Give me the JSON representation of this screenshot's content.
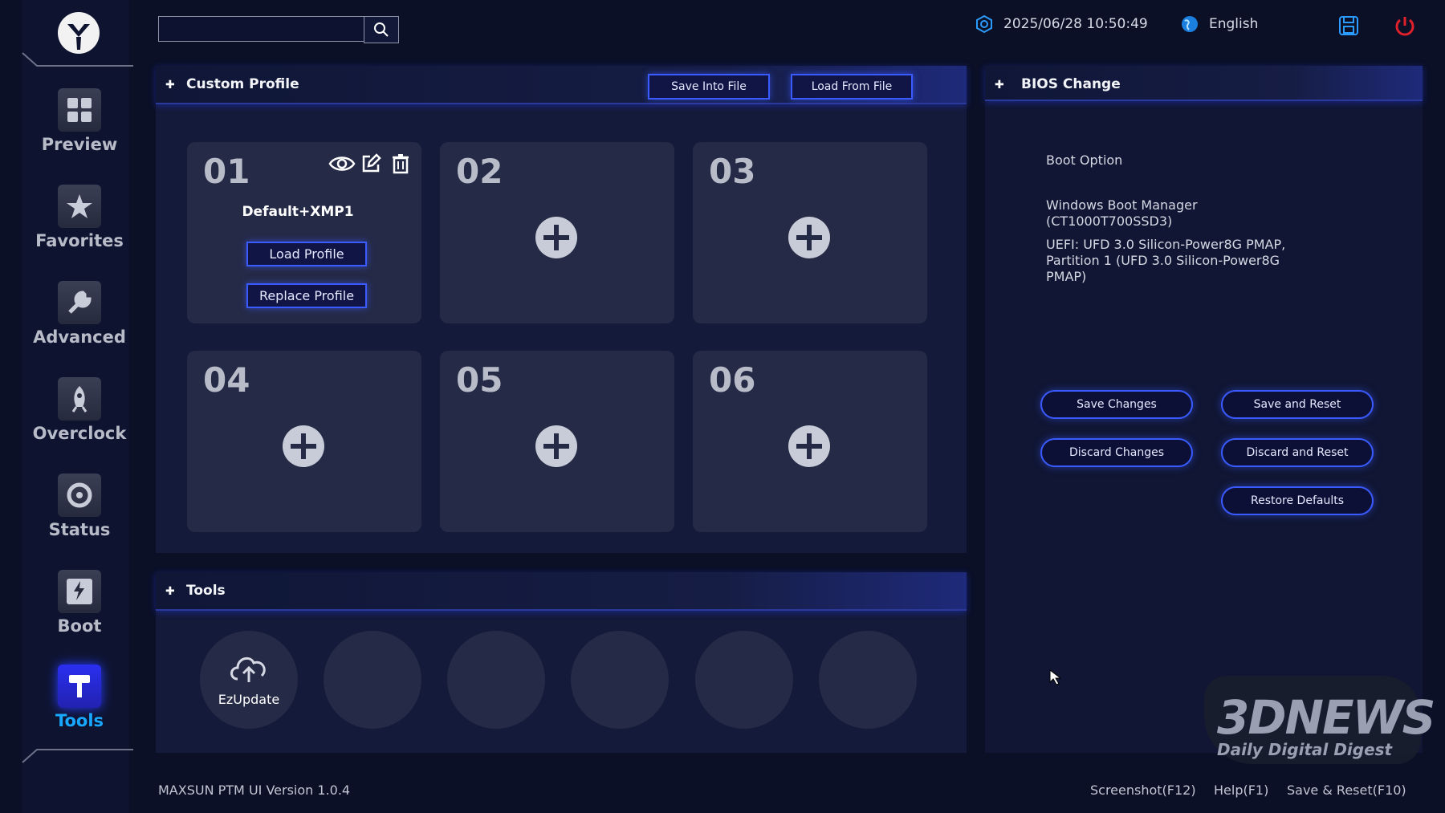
{
  "header": {
    "search_placeholder": "",
    "datetime": "2025/06/28 10:50:49",
    "language": "English"
  },
  "sidebar": {
    "items": [
      {
        "label": "Preview",
        "icon": "grid-icon"
      },
      {
        "label": "Favorites",
        "icon": "star-icon"
      },
      {
        "label": "Advanced",
        "icon": "wrench-icon"
      },
      {
        "label": "Overclock",
        "icon": "rocket-icon"
      },
      {
        "label": "Status",
        "icon": "gauge-icon"
      },
      {
        "label": "Boot",
        "icon": "ssd-icon"
      },
      {
        "label": "Tools",
        "icon": "hammer-icon",
        "active": true
      }
    ]
  },
  "custom_profile": {
    "title": "Custom Profile",
    "save_into_file": "Save Into File",
    "load_from_file": "Load From File",
    "slots": [
      {
        "num": "01",
        "name": "Default+XMP1",
        "load": "Load Profile",
        "replace": "Replace Profile"
      },
      {
        "num": "02"
      },
      {
        "num": "03"
      },
      {
        "num": "04"
      },
      {
        "num": "05"
      },
      {
        "num": "06"
      }
    ]
  },
  "tools": {
    "title": "Tools",
    "items": [
      {
        "label": "EzUpdate",
        "icon": "cloud-upload-icon"
      }
    ]
  },
  "bios_change": {
    "title": "BIOS Change",
    "boot_option_label": "Boot Option",
    "boot_entries": [
      "Windows Boot Manager (CT1000T700SSD3)",
      "UEFI: UFD 3.0 Silicon-Power8G PMAP, Partition 1 (UFD 3.0 Silicon-Power8G PMAP)"
    ],
    "buttons": {
      "save_changes": "Save Changes",
      "save_and_reset": "Save and Reset",
      "discard_changes": "Discard Changes",
      "discard_and_reset": "Discard and Reset",
      "restore_defaults": "Restore Defaults"
    }
  },
  "footer": {
    "version": "MAXSUN PTM UI Version 1.0.4",
    "screenshot": "Screenshot(F12)",
    "help": "Help(F1)",
    "save_reset": "Save & Reset(F10)"
  },
  "watermark": {
    "brand": "3DNEWS",
    "tagline": "Daily Digital Digest"
  },
  "colors": {
    "accent": "#3a5bff",
    "active_nav": "#19a8ff",
    "power": "#e0202a"
  }
}
